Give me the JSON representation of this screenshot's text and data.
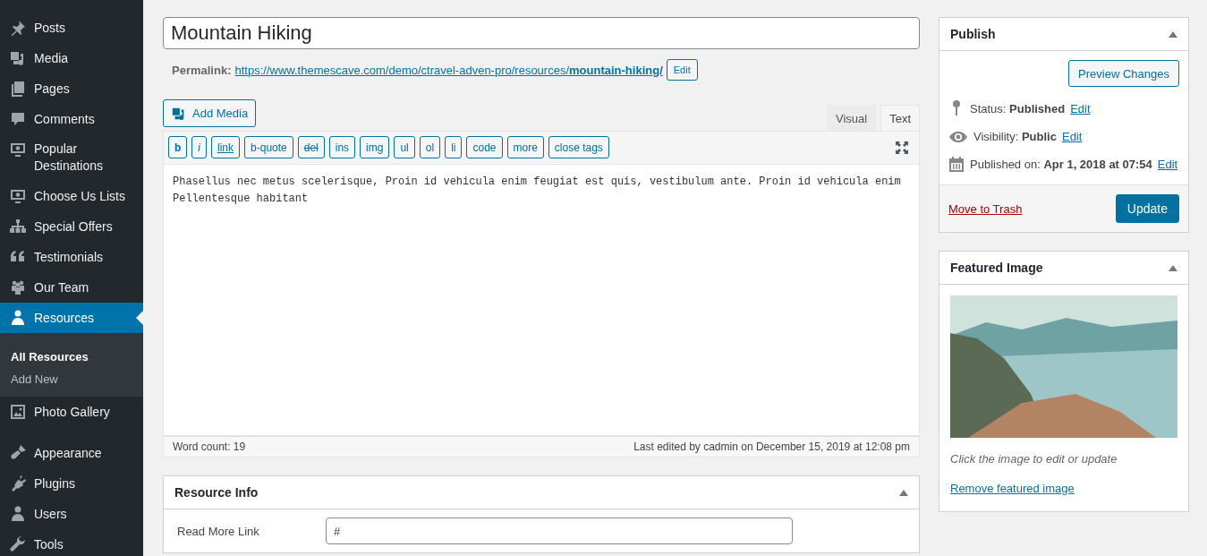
{
  "sidebar": {
    "items": [
      {
        "label": "Posts",
        "selected": false
      },
      {
        "label": "Media",
        "selected": false
      },
      {
        "label": "Pages",
        "selected": false
      },
      {
        "label": "Comments",
        "selected": false
      },
      {
        "label": "Popular Destinations",
        "selected": false
      },
      {
        "label": "Choose Us Lists",
        "selected": false
      },
      {
        "label": "Special Offers",
        "selected": false
      },
      {
        "label": "Testimonials",
        "selected": false
      },
      {
        "label": "Our Team",
        "selected": false
      },
      {
        "label": "Resources",
        "selected": true,
        "children": [
          {
            "label": "All Resources",
            "selected": true
          },
          {
            "label": "Add New",
            "selected": false
          }
        ]
      },
      {
        "label": "Photo Gallery",
        "selected": false
      }
    ],
    "more_items": [
      {
        "label": "Appearance",
        "selected": false
      },
      {
        "label": "Plugins",
        "selected": false
      },
      {
        "label": "Users",
        "selected": false
      },
      {
        "label": "Tools",
        "selected": false
      }
    ]
  },
  "editor": {
    "title": "Mountain Hiking",
    "permalink_label": "Permalink:",
    "permalink": "https://www.themescave.com/demo/ctravel-adven-pro/resources/**mountain-hiking/**",
    "permalink_edit": "Edit",
    "add_media": "Add Media",
    "tabs": [
      {
        "label": "Visual",
        "selected": false
      },
      {
        "label": "Text",
        "selected": true
      }
    ],
    "quicktags": [
      {
        "label": "b",
        "kind": "bold"
      },
      {
        "label": "i",
        "kind": "italic"
      },
      {
        "label": "link",
        "kind": "link"
      },
      {
        "label": "b-quote",
        "kind": "plain"
      },
      {
        "label": "del",
        "kind": "strike"
      },
      {
        "label": "ins",
        "kind": "plain"
      },
      {
        "label": "img",
        "kind": "plain"
      },
      {
        "label": "ul",
        "kind": "plain"
      },
      {
        "label": "ol",
        "kind": "plain"
      },
      {
        "label": "li",
        "kind": "plain"
      },
      {
        "label": "code",
        "kind": "plain"
      },
      {
        "label": "more",
        "kind": "plain"
      },
      {
        "label": "close tags",
        "kind": "plain"
      }
    ],
    "content": "Phasellus nec metus scelerisque, Proin id vehicula enim feugiat est quis, vestibulum ante. Proin id vehicula enim\nPellentesque habitant",
    "word_count": "Word count: 19",
    "last_edited": "Last edited by cadmin on December 15, 2019 at 12:08 pm"
  },
  "resource_info": {
    "title": "Resource Info",
    "fields": [
      {
        "label": "Read More Link",
        "value": "#"
      }
    ]
  },
  "publish": {
    "title": "Publish",
    "preview": "Preview Changes",
    "rows": [
      {
        "text": "Status: **Published**",
        "edit": "Edit"
      },
      {
        "text": "Visibility: **Public**",
        "edit": "Edit"
      },
      {
        "text": "Published on: **Apr 1, 2018 at 07:54**",
        "edit": "Edit"
      }
    ],
    "trash": "Move to Trash",
    "update": "Update"
  },
  "featured_image": {
    "title": "Featured Image",
    "caption": "Click the image to edit or update",
    "remove": "Remove featured image"
  }
}
